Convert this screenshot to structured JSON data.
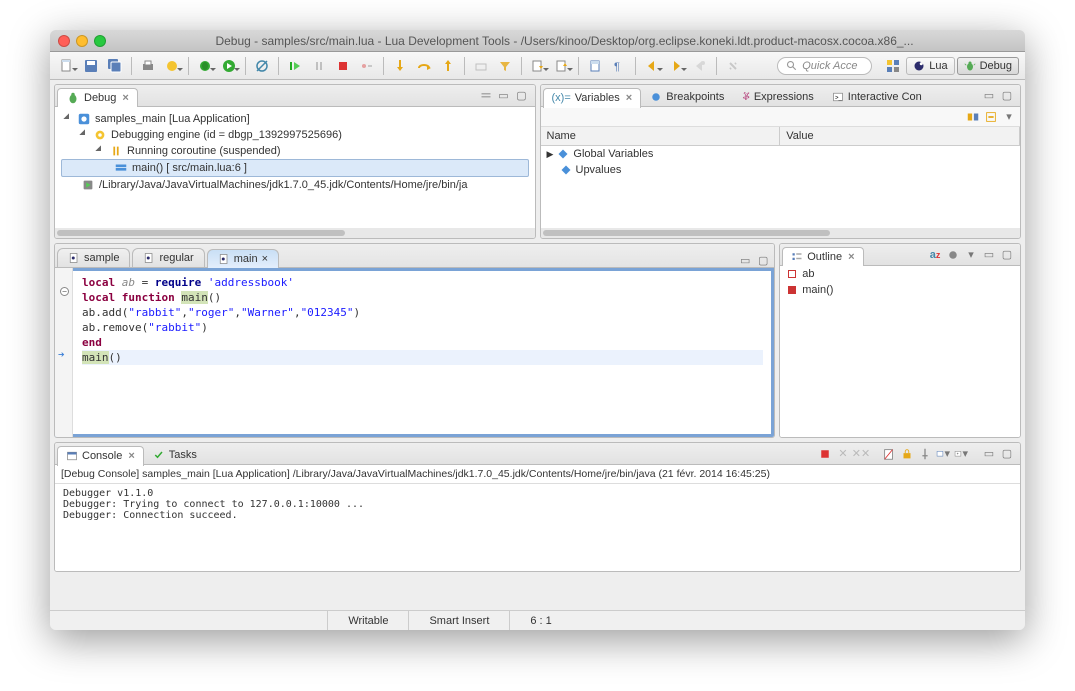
{
  "window": {
    "title": "Debug - samples/src/main.lua - Lua Development Tools - /Users/kinoo/Desktop/org.eclipse.koneki.ldt.product-macosx.cocoa.x86_..."
  },
  "quick_access": {
    "placeholder": "Quick Acce"
  },
  "perspectives": {
    "lua": "Lua",
    "debug": "Debug"
  },
  "debug_view": {
    "title": "Debug",
    "tree": {
      "app": "samples_main [Lua Application]",
      "engine": "Debugging engine (id = dbgp_1392997525696)",
      "coroutine": "Running coroutine (suspended)",
      "frame": "main()  [ src/main.lua:6 ]",
      "jvm": "/Library/Java/JavaVirtualMachines/jdk1.7.0_45.jdk/Contents/Home/jre/bin/ja"
    }
  },
  "variables_view": {
    "tabs": {
      "variables": "Variables",
      "breakpoints": "Breakpoints",
      "expressions": "Expressions",
      "interactive": "Interactive Con"
    },
    "columns": {
      "name": "Name",
      "value": "Value"
    },
    "rows": {
      "globals": "Global Variables",
      "upvalues": "Upvalues"
    }
  },
  "editor": {
    "tabs": {
      "sample": "sample",
      "regular": "regular",
      "main": "main"
    },
    "code": {
      "l1a": "local ",
      "l1b": "ab",
      "l1c": " = ",
      "l1d": "require",
      "l1e": " 'addressbook'",
      "l2a": "local function ",
      "l2b": "main",
      "l2c": "()",
      "l3": "   ab.add(\"rabbit\",\"roger\",\"Warner\",\"012345\")",
      "l4": "   ab.remove(\"rabbit\")",
      "l5": "end",
      "l6a": "main",
      "l6b": "()"
    }
  },
  "outline": {
    "title": "Outline",
    "items": {
      "ab": "ab",
      "main": "main()"
    }
  },
  "console": {
    "tab_console": "Console",
    "tab_tasks": "Tasks",
    "title": "[Debug Console] samples_main [Lua Application] /Library/Java/JavaVirtualMachines/jdk1.7.0_45.jdk/Contents/Home/jre/bin/java (21 févr. 2014 16:45:25)",
    "line1": "Debugger v1.1.0",
    "line2": "Debugger: Trying to connect to 127.0.0.1:10000 ...",
    "line3": "Debugger: Connection succeed."
  },
  "status": {
    "writable": "Writable",
    "insert": "Smart Insert",
    "pos": "6 : 1"
  }
}
